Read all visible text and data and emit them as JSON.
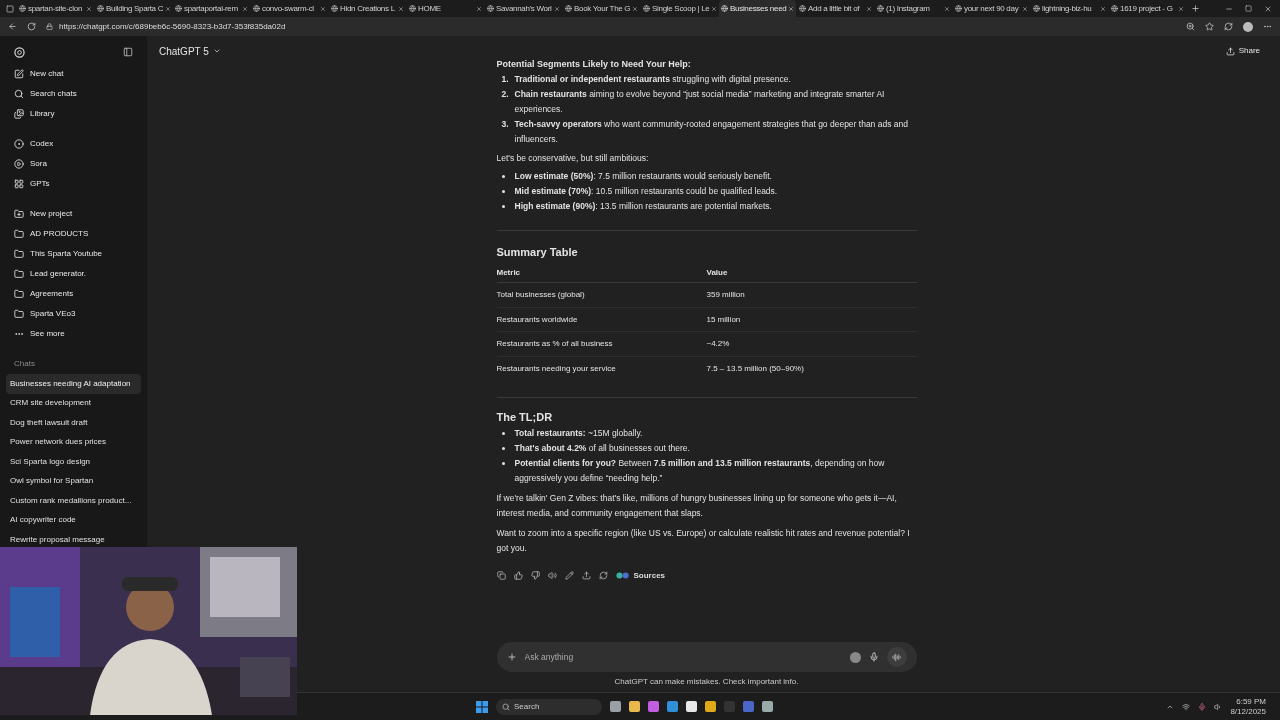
{
  "browser": {
    "tabs": [
      {
        "title": "spartan-site-clon",
        "selected": false
      },
      {
        "title": "Building Sparta C",
        "selected": false
      },
      {
        "title": "spartaportal-rem",
        "selected": false
      },
      {
        "title": "convo-swarm-cl",
        "selected": false
      },
      {
        "title": "Hidn Creations L",
        "selected": false
      },
      {
        "title": "HOME",
        "selected": false
      },
      {
        "title": "Savannah's Worl",
        "selected": false
      },
      {
        "title": "Book Your The G",
        "selected": false
      },
      {
        "title": "Single Scoop | Le",
        "selected": false
      },
      {
        "title": "Businesses need",
        "selected": true
      },
      {
        "title": "Add a little bit of",
        "selected": false
      },
      {
        "title": "(1) Instagram",
        "selected": false
      },
      {
        "title": "your next 90 day",
        "selected": false
      },
      {
        "title": "lightning-biz-hu",
        "selected": false
      },
      {
        "title": "1619 project - G",
        "selected": false
      }
    ],
    "url": "https://chatgpt.com/c/689beb6c-5690-8323-b3d7-353f835da02d"
  },
  "sidebar": {
    "nav": [
      "New chat",
      "Search chats",
      "Library"
    ],
    "tools": [
      "Codex",
      "Sora",
      "GPTs"
    ],
    "projects": [
      "New project",
      "AD PRODUCTS",
      "This Sparta Youtube",
      "Lead generator.",
      "Agreements",
      "Sparta VEo3",
      "See more"
    ],
    "chats_heading": "Chats",
    "chats": [
      {
        "title": "Businesses needing AI adaptation",
        "selected": true
      },
      {
        "title": "CRM site development",
        "selected": false
      },
      {
        "title": "Dog theft lawsuit draft",
        "selected": false
      },
      {
        "title": "Power network dues prices",
        "selected": false
      },
      {
        "title": "Sci Sparta logo design",
        "selected": false
      },
      {
        "title": "Owl symbol for Spartan",
        "selected": false
      },
      {
        "title": "Custom rank medallions product...",
        "selected": false
      },
      {
        "title": "AI copywriter code",
        "selected": false
      },
      {
        "title": "Rewrite proposal message",
        "selected": false
      }
    ]
  },
  "header": {
    "model": "ChatGPT 5",
    "share": "Share"
  },
  "message": {
    "heading_top": "Potential Segments Likely to Need Your Help:",
    "segments": [
      {
        "number": "1.",
        "text": "**Traditional or independent restaurants** struggling with digital presence."
      },
      {
        "number": "2.",
        "text": "**Chain restaurants** aiming to evolve beyond “just social media” marketing and integrate smarter AI experiences."
      },
      {
        "number": "3.",
        "text": "**Tech-savvy operators** who want community-rooted engagement strategies that go deeper than ads and influencers."
      }
    ],
    "intro": "Let's be conservative, but still ambitious:",
    "estimates": [
      "**Low estimate (50%)**: 7.5 million restaurants would seriously benefit.",
      "**Mid estimate (70%)**: 10.5 million restaurants could be qualified leads.",
      "**High estimate (90%)**: 13.5 million restaurants are potential markets."
    ],
    "table_title": "Summary Table",
    "table": {
      "columns": [
        "Metric",
        "Value"
      ],
      "rows": [
        [
          "Total businesses (global)",
          "359 million"
        ],
        [
          "Restaurants worldwide",
          "15 million"
        ],
        [
          "Restaurants as % of all business",
          "~4.2%"
        ],
        [
          "Restaurants needing your service",
          "7.5 – 13.5 million (50–90%)"
        ]
      ]
    },
    "tldr_title": "The TL;DR",
    "tldr": [
      "**Total restaurants:** ~15M globally.",
      "**That's about 4.2%** of all businesses out there.",
      "**Potential clients for you?** Between **7.5 million and 13.5 million restaurants**, depending on how aggressively you define “needing help.”"
    ],
    "paragraphs": [
      "If we're talkin' Gen Z vibes: that's like, millions of hungry businesses lining up for someone who gets it—AI, interest media, and community engagement that slaps.",
      "Want to zoom into a specific region (like US vs. Europe) or calculate realistic hit rates and revenue potential? I got you."
    ],
    "sources": "Sources"
  },
  "composer": {
    "placeholder": "Ask anything",
    "disclaimer": "ChatGPT can make mistakes. Check important info."
  },
  "taskbar": {
    "search_placeholder": "Search",
    "time": "6:59 PM",
    "date": "8/12/2025"
  }
}
